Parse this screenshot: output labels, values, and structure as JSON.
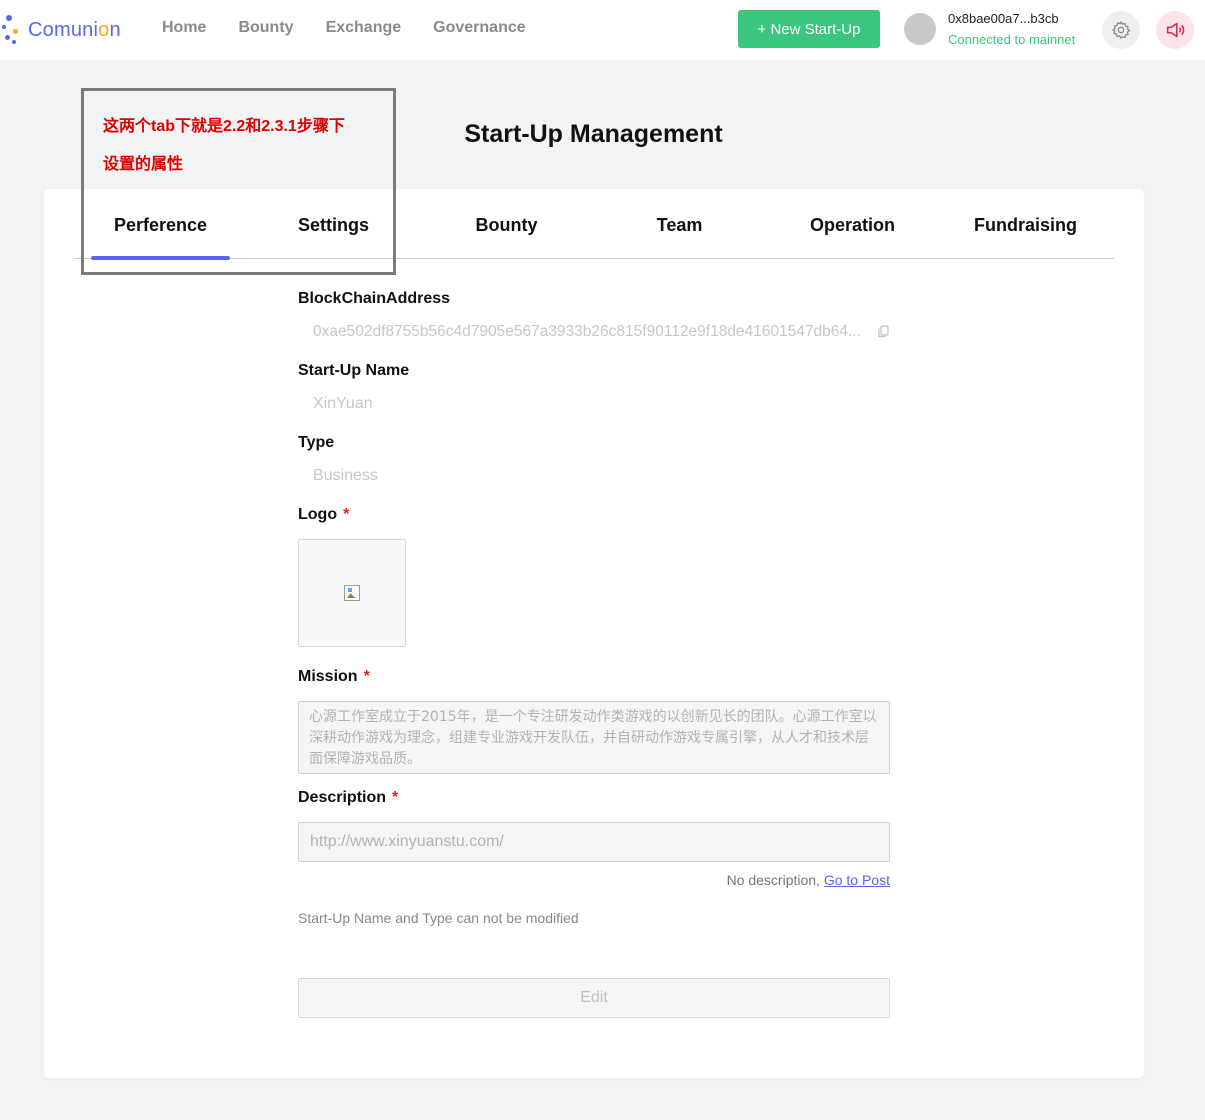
{
  "header": {
    "logo_text_1": "Comuni",
    "logo_text_o": "o",
    "logo_text_2": "n",
    "nav": [
      "Home",
      "Bounty",
      "Exchange",
      "Governance"
    ],
    "new_startup_label": "+ New Start-Up",
    "account_address": "0x8bae00a7...b3cb",
    "account_status": "Connected to mainnet",
    "icons": [
      "gear-icon",
      "speaker-icon"
    ],
    "colors": {
      "brand": "#5a67e8",
      "green": "#3cc57f",
      "accent_o": "#f5a623",
      "speaker": "#e0264a"
    }
  },
  "page": {
    "title": "Start-Up Management"
  },
  "annotation": {
    "line1": "这两个tab下就是2.2和2.3.1步骤下",
    "line2": "设置的属性",
    "color": "#e00000"
  },
  "tabs": [
    {
      "label": "Perference",
      "active": true
    },
    {
      "label": "Settings",
      "active": false
    },
    {
      "label": "Bounty",
      "active": false
    },
    {
      "label": "Team",
      "active": false
    },
    {
      "label": "Operation",
      "active": false
    },
    {
      "label": "Fundraising",
      "active": false
    }
  ],
  "form": {
    "blockchain_address_label": "BlockChainAddress",
    "blockchain_address_value": "0xae502df8755b56c4d7905e567a3933b26c815f90112e9f18de41601547db64...",
    "startup_name_label": "Start-Up Name",
    "startup_name_value": "XinYuan",
    "type_label": "Type",
    "type_value": "Business",
    "logo_label": "Logo",
    "mission_label": "Mission",
    "mission_value": "心源工作室成立于2015年，是一个专注研发动作类游戏的以创新见长的团队。心源工作室以深耕动作游戏为理念，组建专业游戏开发队伍，并自研动作游戏专属引擎，从人才和技术层面保障游戏品质。",
    "description_label": "Description",
    "description_value": "http://www.xinyuanstu.com/",
    "required_mark": "*",
    "no_description_text": "No description,",
    "go_to_post_label": "Go to Post",
    "note": "Start-Up Name and Type can not be modified",
    "edit_label": "Edit"
  }
}
